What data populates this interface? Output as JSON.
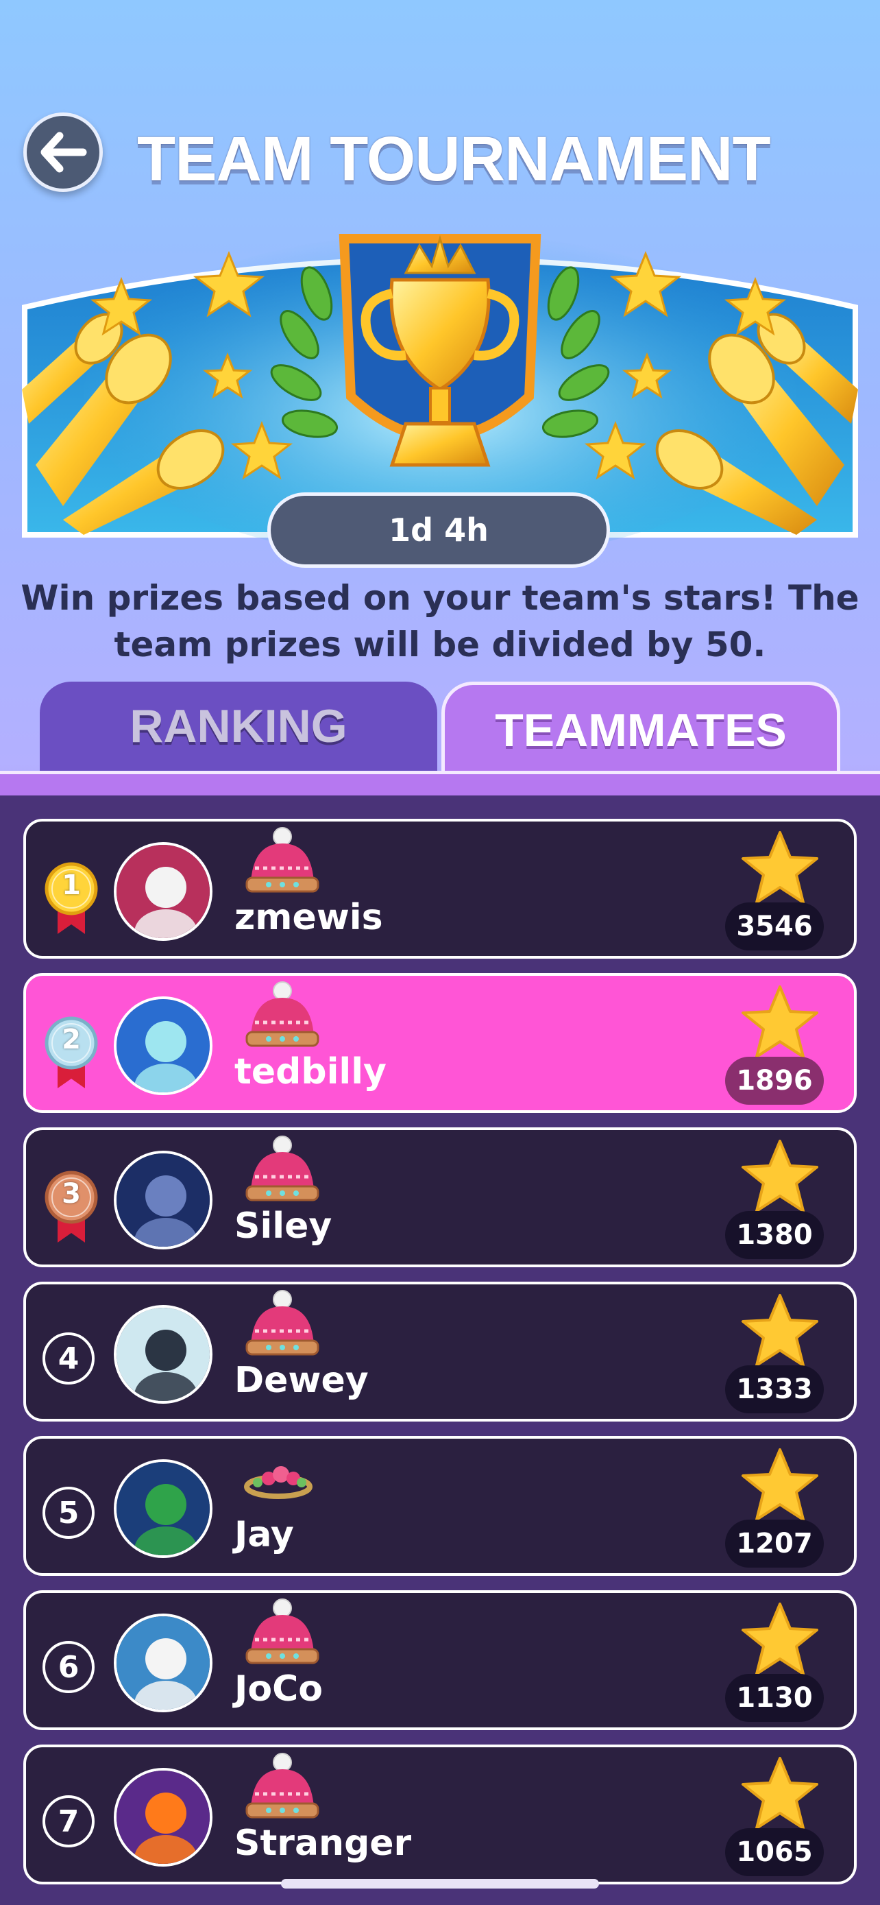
{
  "header": {
    "title": "TEAM TOURNAMENT",
    "back_icon": "arrow-left-icon"
  },
  "banner": {
    "timer": "1d 4h",
    "description": "Win prizes based on your team's stars! The team prizes will be divided by 50."
  },
  "tabs": [
    {
      "label": "RANKING",
      "selected": false
    },
    {
      "label": "TEAMMATES",
      "selected": true
    }
  ],
  "colors": {
    "highlight_row": "#ff55d6",
    "row_bg": "#2b2040",
    "list_bg": "#4a3378",
    "star": "#ffc933"
  },
  "teammates": [
    {
      "rank": "1",
      "name": "zmewis",
      "score": "3546",
      "medal": "gold",
      "avatar": "santa-avatar",
      "hat": "knit-hat-icon"
    },
    {
      "rank": "2",
      "name": "tedbilly",
      "score": "1896",
      "medal": "silver",
      "avatar": "unicorn-avatar",
      "hat": "knit-hat-icon"
    },
    {
      "rank": "3",
      "name": "Siley",
      "score": "1380",
      "medal": "bronze",
      "avatar": "raven-avatar",
      "hat": "knit-hat-icon"
    },
    {
      "rank": "4",
      "name": "Dewey",
      "score": "1333",
      "medal": "none",
      "avatar": "penguin-avatar",
      "hat": "knit-hat-icon"
    },
    {
      "rank": "5",
      "name": "Jay",
      "score": "1207",
      "medal": "none",
      "avatar": "christmas-tree-avatar",
      "hat": "flower-crown-icon"
    },
    {
      "rank": "6",
      "name": "JoCo",
      "score": "1130",
      "medal": "none",
      "avatar": "snowman-avatar",
      "hat": "knit-hat-icon"
    },
    {
      "rank": "7",
      "name": "Stranger",
      "score": "1065",
      "medal": "none",
      "avatar": "phoenix-avatar",
      "hat": "knit-hat-icon"
    }
  ]
}
